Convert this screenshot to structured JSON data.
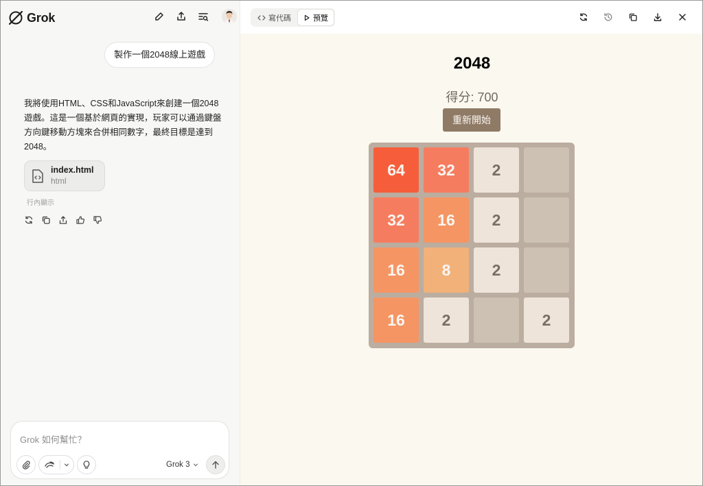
{
  "app": {
    "name": "Grok"
  },
  "user_message": "製作一個2048線上遊戲",
  "assistant": {
    "text": "我將使用HTML、CSS和JavaScript來創建一個2048遊戲。這是一個基於網頁的實現，玩家可以通過鍵盤方向鍵移動方塊來合併相同數字，最終目標是達到2048。",
    "file": {
      "name": "index.html",
      "type": "html"
    },
    "inline_label": "行內顯示"
  },
  "composer": {
    "placeholder": "Grok 如何幫忙？",
    "model": "Grok 3"
  },
  "preview": {
    "tabs": [
      {
        "label": "寫代碼",
        "icon": "code-icon"
      },
      {
        "label": "預覽",
        "icon": "play-icon",
        "active": true
      }
    ],
    "game": {
      "title": "2048",
      "score_label": "得分: 700",
      "restart_label": "重新開始",
      "grid": [
        [
          "64",
          "32",
          "2",
          ""
        ],
        [
          "32",
          "16",
          "2",
          ""
        ],
        [
          "16",
          "8",
          "2",
          ""
        ],
        [
          "16",
          "2",
          "",
          "2"
        ]
      ]
    }
  },
  "colors": {
    "tile_bg": {
      "2": "#eee4da",
      "8": "#f2b179",
      "16": "#f59563",
      "32": "#f67c5f",
      "64": "#f65e3b",
      "empty": "#cdc1b4"
    },
    "tile_text_dark": "#776e65",
    "tile_text_light": "#f9f6f2",
    "board": "#bbada0",
    "restart_button": "#8f7a66",
    "preview_bg": "#fbf8ef"
  }
}
